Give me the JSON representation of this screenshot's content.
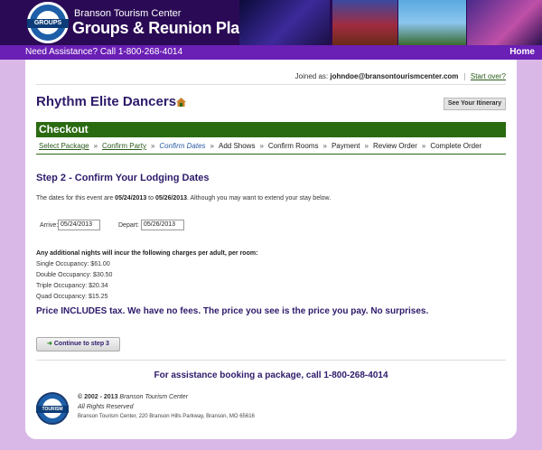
{
  "header": {
    "brand_top": "Branson Tourism Center",
    "brand_main": "Groups & Reunion Planner",
    "seal_text": "GROUPS"
  },
  "topbar": {
    "assist": "Need Assistance? Call 1-800-268-4014",
    "home": "Home"
  },
  "account": {
    "joined_label": "Joined as:",
    "email": "johndoe@bransontourismcenter.com",
    "start_over": "Start over?"
  },
  "page": {
    "title": "Rhythm Elite Dancers",
    "itinerary_button": "See Your Itinerary"
  },
  "checkout": {
    "title": "Checkout",
    "steps": [
      {
        "label": "Select Package",
        "state": "done"
      },
      {
        "label": "Confirm Party",
        "state": "done"
      },
      {
        "label": "Confirm Dates",
        "state": "current"
      },
      {
        "label": "Add Shows",
        "state": "todo"
      },
      {
        "label": "Confirm Rooms",
        "state": "todo"
      },
      {
        "label": "Payment",
        "state": "todo"
      },
      {
        "label": "Review Order",
        "state": "todo"
      },
      {
        "label": "Complete Order",
        "state": "todo"
      }
    ],
    "separator": "»"
  },
  "lodging": {
    "heading": "Step 2 - Confirm Your Lodging Dates",
    "dates_prefix": "The dates for this event are ",
    "start_date": "05/24/2013",
    "dates_mid": " to ",
    "end_date": "05/26/2013",
    "dates_suffix": ". Although you may want to extend your stay below.",
    "arrive_label": "Arrive:",
    "arrive_value": "05/24/2013",
    "depart_label": "Depart:",
    "depart_value": "05/26/2013"
  },
  "charges": {
    "heading": "Any additional nights will incur the following charges per adult, per room:",
    "single": "Single Occupancy: $61.00",
    "double": "Double Occupancy: $30.50",
    "triple": "Triple Occupancy: $20.34",
    "quad": "Quad Occupancy: $15.25"
  },
  "includes_tax": "Price INCLUDES tax. We have no fees. The price you see is the price you pay. No surprises.",
  "continue_button": "Continue to step 3",
  "assist_big": "For assistance booking a package, call 1-800-268-4014",
  "footer": {
    "copyright": "© 2002 - 2013",
    "company": "Branson Tourism Center",
    "rights": "All Rights Reserved",
    "address": "Branson Tourism Center, 220 Branson Hills Parkway, Branson, MO 65616",
    "seal_text": "TOURISM"
  },
  "colors": {
    "accent_purple": "#6a1fb5",
    "title_navy": "#2e1a6a",
    "checkout_green": "#2a6a10"
  }
}
